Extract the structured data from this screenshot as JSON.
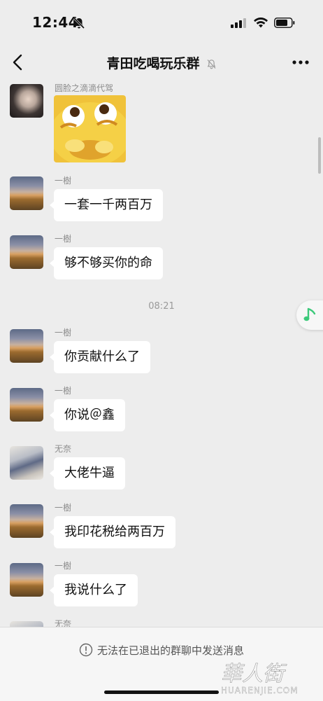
{
  "status_bar": {
    "time": "12:44"
  },
  "header": {
    "title": "青田吃喝玩乐群"
  },
  "messages": [
    {
      "sender": "圆脸之滴滴代驾",
      "type": "sticker"
    },
    {
      "sender": "一樹",
      "text": "一套一千两百万"
    },
    {
      "sender": "一樹",
      "text": "够不够买你的命"
    },
    {
      "sender": "一樹",
      "text": "你贡献什么了"
    },
    {
      "sender": "一樹",
      "text": "你说＠鑫"
    },
    {
      "sender": "无奈",
      "text": "大佬牛逼"
    },
    {
      "sender": "一樹",
      "text": "我印花税给两百万"
    },
    {
      "sender": "一樹",
      "text": "我说什么了"
    },
    {
      "sender": "无奈"
    }
  ],
  "timestamp": "08:21",
  "footer": {
    "notice": "无法在已退出的群聊中发送消息"
  },
  "watermark": {
    "text": "華人街",
    "sub": "HUARENJIE.COM"
  }
}
